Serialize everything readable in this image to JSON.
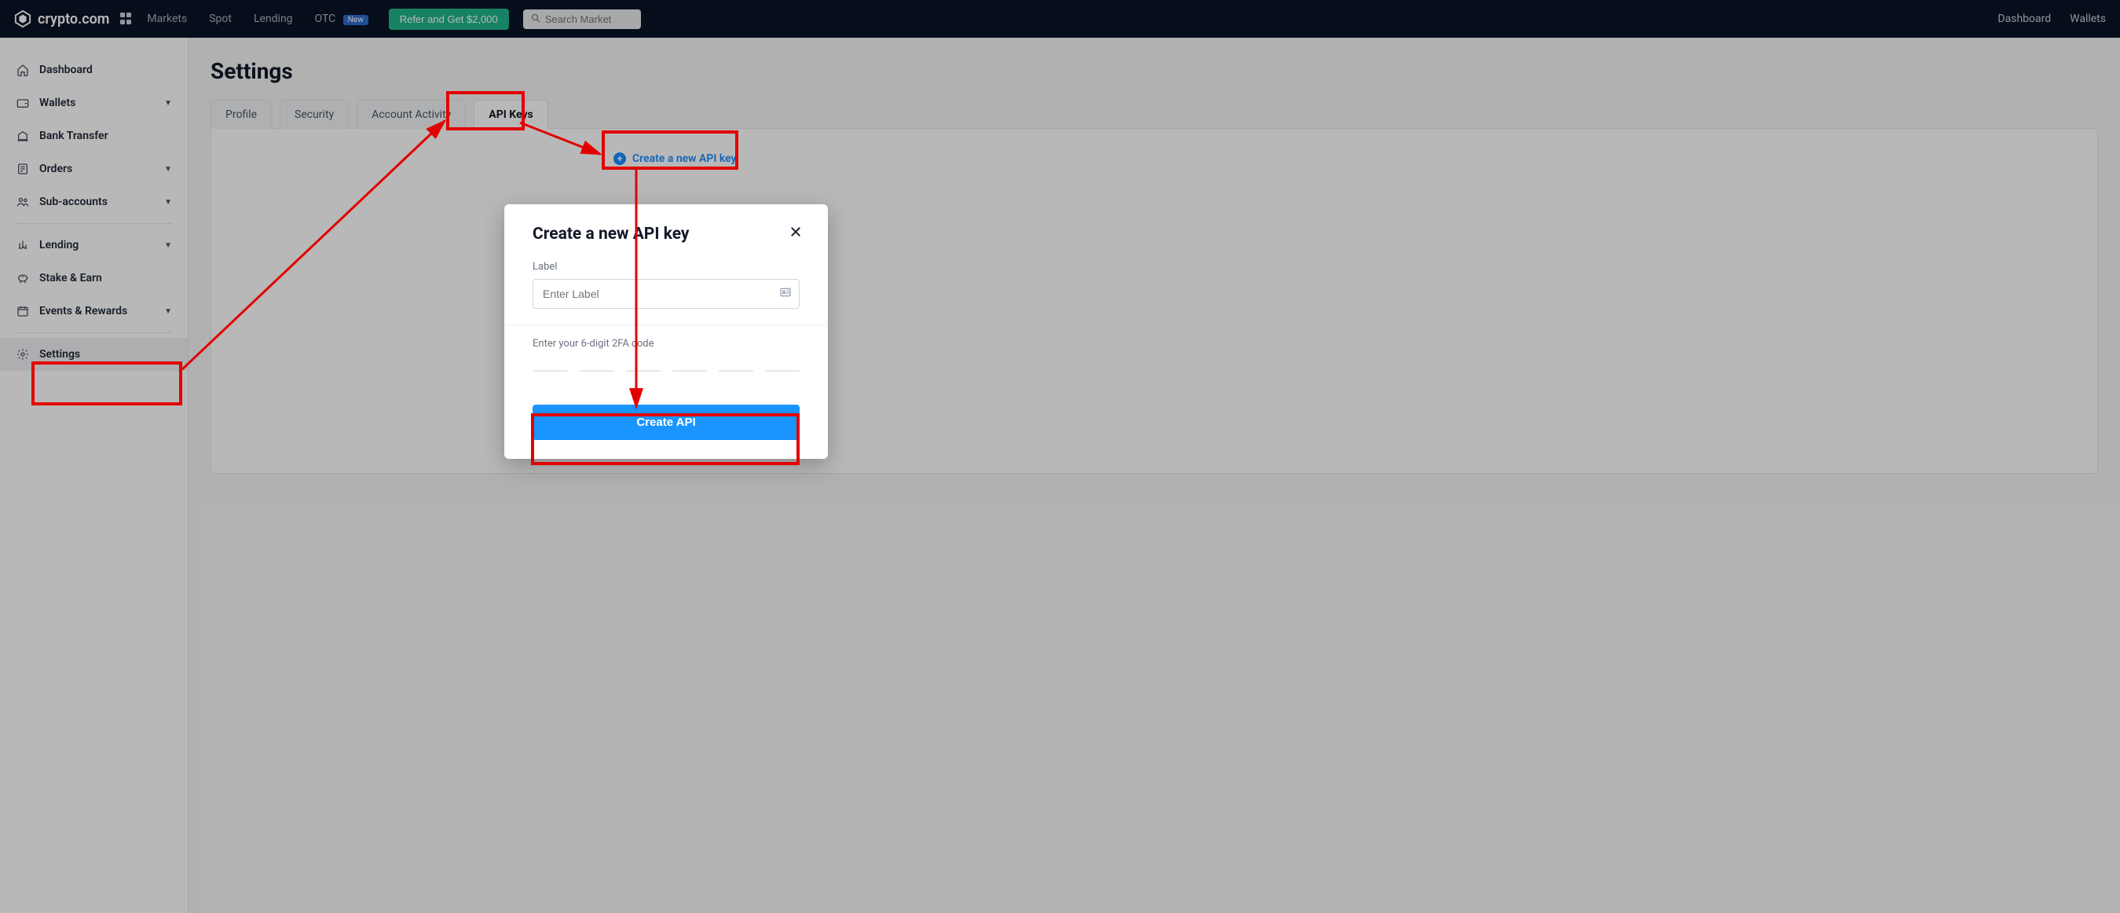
{
  "nav": {
    "brand": "crypto.com",
    "links": {
      "markets": "Markets",
      "spot": "Spot",
      "lending": "Lending",
      "otc": "OTC",
      "new_badge": "New"
    },
    "refer": "Refer and Get $2,000",
    "search_placeholder": "Search Market",
    "right": {
      "dashboard": "Dashboard",
      "wallets": "Wallets"
    }
  },
  "sidebar": {
    "dashboard": "Dashboard",
    "wallets": "Wallets",
    "bank_transfer": "Bank Transfer",
    "orders": "Orders",
    "sub_accounts": "Sub-accounts",
    "lending": "Lending",
    "stake_earn": "Stake & Earn",
    "events_rewards": "Events & Rewards",
    "settings": "Settings"
  },
  "page": {
    "title": "Settings"
  },
  "tabs": {
    "profile": "Profile",
    "security": "Security",
    "account_activity": "Account Activity",
    "api_keys": "API Keys"
  },
  "panel": {
    "create_link": "Create a new API key"
  },
  "modal": {
    "title": "Create a new API key",
    "label_field": "Label",
    "label_placeholder": "Enter Label",
    "twofa_prompt": "Enter your 6-digit 2FA code",
    "create_button": "Create API"
  }
}
